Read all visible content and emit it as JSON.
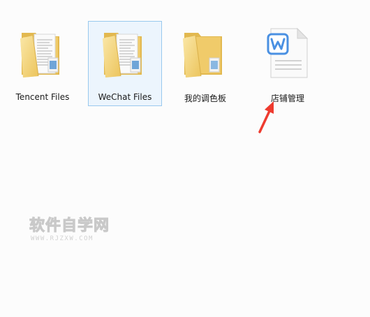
{
  "desktop": {
    "items": [
      {
        "label": "Tencent Files",
        "icon": "folder-icon",
        "selected": false
      },
      {
        "label": "WeChat Files",
        "icon": "folder-icon",
        "selected": true
      },
      {
        "label": "我的调色板",
        "icon": "folder-icon",
        "selected": false
      },
      {
        "label": "店铺管理",
        "icon": "wps-writer-document-icon",
        "selected": false
      }
    ]
  },
  "annotation": {
    "arrow_color": "#ee3b2f"
  },
  "watermark": {
    "main": "软件自学网",
    "sub": "WWW.RJZXW.COM"
  },
  "colors": {
    "selection_border": "#99c9ee",
    "selection_fill": "#cde8ff",
    "folder_yellow": "#f2cf6d",
    "doc_blue": "#4a90e2"
  }
}
